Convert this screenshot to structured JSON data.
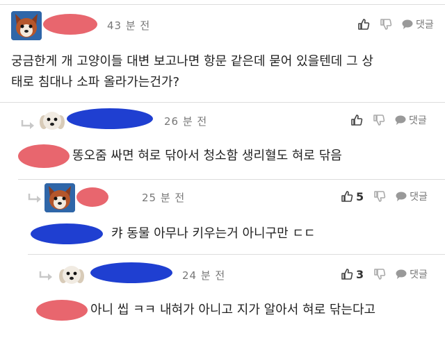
{
  "comments": [
    {
      "time": "43 분 전",
      "body_lines": [
        "궁금한게 개 고양이들 대변 보고나면 항문 같은데 묻어 있을텐데 그 상",
        "태로 침대나 소파 올라가는건가?"
      ],
      "like_count": "",
      "reply_label": "댓글",
      "avatar": "fox-avatar-icon"
    },
    {
      "time": "26 분 전",
      "body": "똥오줌 싸면 혀로 닦아서 청소함 생리혈도 혀로 닦음",
      "like_count": "",
      "reply_label": "댓글",
      "avatar": "dog-avatar-icon"
    },
    {
      "time": "25 분 전",
      "body": "캬 동물 아무나 키우는거 아니구만 ㄷㄷ",
      "like_count": "5",
      "reply_label": "댓글",
      "avatar": "fox-avatar-icon"
    },
    {
      "time": "24 분 전",
      "body": "아니 씹 ㅋㅋ 내혀가 아니고 지가 알아서 혀로 닦는다고",
      "like_count": "3",
      "reply_label": "댓글",
      "avatar": "dog-avatar-icon"
    }
  ],
  "colors": {
    "redact_red": "#e8666e",
    "redact_blue": "#1f3fd1",
    "muted": "#777777",
    "rule": "#dcdcdc"
  }
}
